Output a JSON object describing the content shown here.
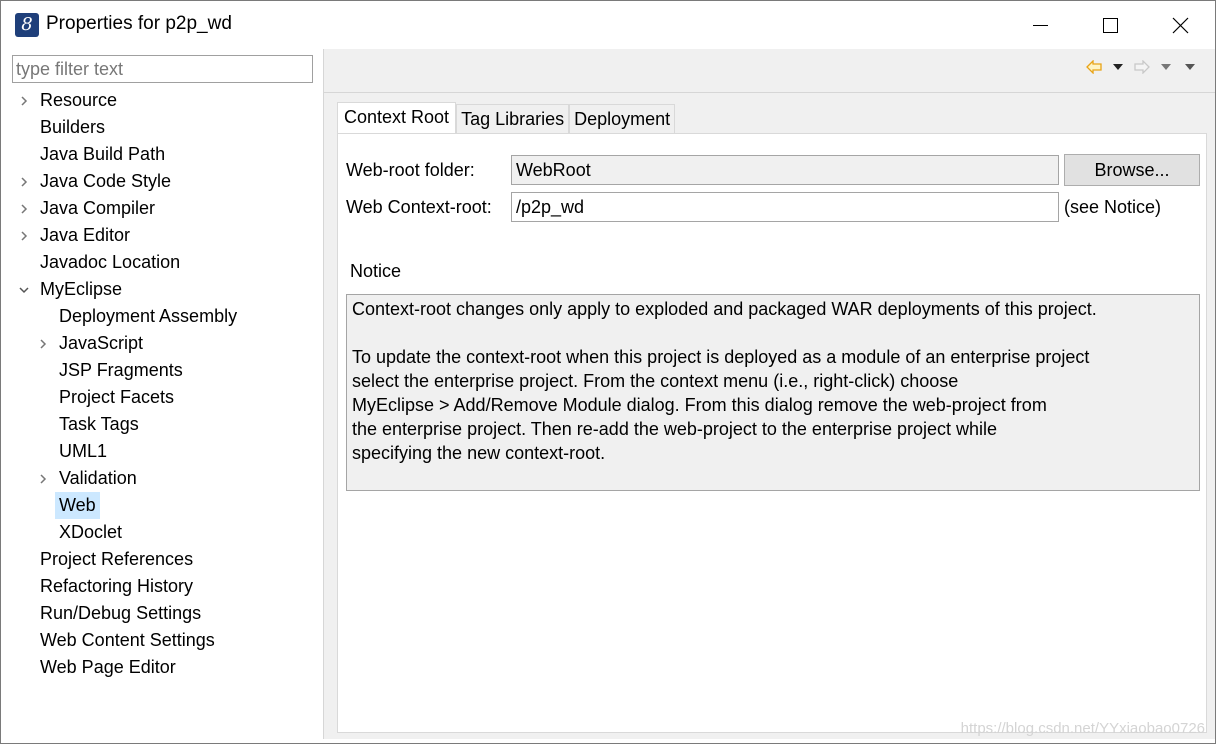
{
  "window": {
    "title": "Properties for p2p_wd",
    "app_icon_glyph": "8"
  },
  "filter": {
    "placeholder": "type filter text"
  },
  "tree": {
    "items": [
      {
        "label": "Resource",
        "level": 0,
        "chevron": "right"
      },
      {
        "label": "Builders",
        "level": 0,
        "chevron": "none"
      },
      {
        "label": "Java Build Path",
        "level": 0,
        "chevron": "none"
      },
      {
        "label": "Java Code Style",
        "level": 0,
        "chevron": "right"
      },
      {
        "label": "Java Compiler",
        "level": 0,
        "chevron": "right"
      },
      {
        "label": "Java Editor",
        "level": 0,
        "chevron": "right"
      },
      {
        "label": "Javadoc Location",
        "level": 0,
        "chevron": "none"
      },
      {
        "label": "MyEclipse",
        "level": 0,
        "chevron": "down"
      },
      {
        "label": "Deployment Assembly",
        "level": 1,
        "chevron": "none"
      },
      {
        "label": "JavaScript",
        "level": 1,
        "chevron": "right"
      },
      {
        "label": "JSP Fragments",
        "level": 1,
        "chevron": "none"
      },
      {
        "label": "Project Facets",
        "level": 1,
        "chevron": "none"
      },
      {
        "label": "Task Tags",
        "level": 1,
        "chevron": "none"
      },
      {
        "label": "UML1",
        "level": 1,
        "chevron": "none"
      },
      {
        "label": "Validation",
        "level": 1,
        "chevron": "right"
      },
      {
        "label": "Web",
        "level": 1,
        "chevron": "none",
        "selected": true
      },
      {
        "label": "XDoclet",
        "level": 1,
        "chevron": "none"
      },
      {
        "label": "Project References",
        "level": 0,
        "chevron": "none"
      },
      {
        "label": "Refactoring History",
        "level": 0,
        "chevron": "none"
      },
      {
        "label": "Run/Debug Settings",
        "level": 0,
        "chevron": "none"
      },
      {
        "label": "Web Content Settings",
        "level": 0,
        "chevron": "none"
      },
      {
        "label": "Web Page Editor",
        "level": 0,
        "chevron": "none"
      }
    ]
  },
  "tabs": [
    {
      "label": "Context Root",
      "active": true
    },
    {
      "label": "Tag Libraries",
      "active": false
    },
    {
      "label": "Deployment",
      "active": false
    }
  ],
  "form": {
    "web_root_label": "Web-root folder:",
    "web_root_value": "WebRoot",
    "browse_label": "Browse...",
    "context_root_label": "Web Context-root:",
    "context_root_value": "/p2p_wd",
    "see_notice": "(see Notice)"
  },
  "notice": {
    "heading": "Notice",
    "para1": "Context-root changes only apply to exploded and packaged WAR deployments of this project.",
    "para2_lines": [
      "To update the context-root when this project is deployed as a module of an enterprise project",
      "select the enterprise project. From the context menu (i.e., right-click) choose",
      "MyEclipse > Add/Remove Module dialog. From this dialog remove the web-project from",
      "the enterprise project. Then re-add the web-project to the enterprise project while",
      "specifying the new context-root."
    ]
  },
  "watermark": "https://blog.csdn.net/YYxiaobao0726",
  "colors": {
    "selection": "#cce8ff",
    "panel_bg": "#f0f0f0",
    "nav_back_arrow": "#e8a317",
    "nav_forward_arrow": "#c8c8c8"
  }
}
